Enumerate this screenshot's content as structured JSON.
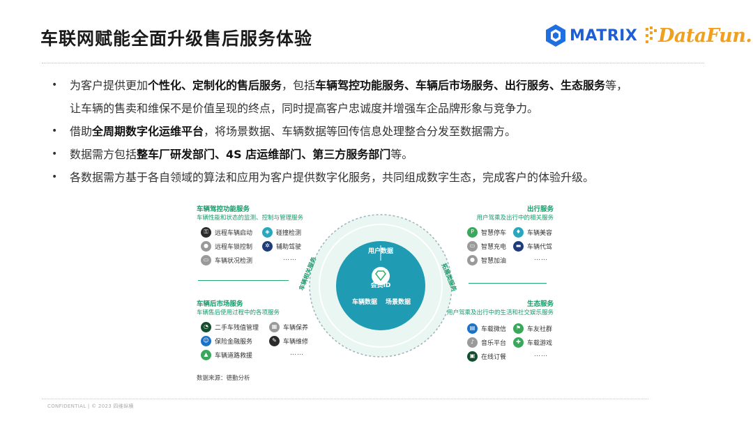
{
  "title": "车联网赋能全面升级售后服务体验",
  "logos": {
    "matrix": "MATRIX",
    "datafun": "DataFun."
  },
  "bullets": [
    {
      "line1": [
        {
          "t": "为客户提供更加",
          "b": false
        },
        {
          "t": "个性化、定制化的售后服务",
          "b": true
        },
        {
          "t": "，包括",
          "b": false
        },
        {
          "t": "车辆驾控功能服务、车辆后市场服务、出行服务、生态服务",
          "b": true
        },
        {
          "t": "等，",
          "b": false
        }
      ],
      "line2": "让车辆的售卖和维保不是价值呈现的终点，同时提高客户忠诚度并增强车企品牌形象与竞争力。"
    },
    {
      "line1": [
        {
          "t": "借助",
          "b": false
        },
        {
          "t": "全周期数字化运维平台",
          "b": true
        },
        {
          "t": "，将场景数据、车辆数据等回传信息处理整合分发至数据需方。",
          "b": false
        }
      ]
    },
    {
      "line1": [
        {
          "t": "数据需方包括",
          "b": false
        },
        {
          "t": "整车厂研发部门、4S 店运维部门、第三方服务部门",
          "b": true
        },
        {
          "t": "等。",
          "b": false
        }
      ]
    },
    {
      "line1": [
        {
          "t": "各数据需方基于各自领域的算法和应用为客户提供数字化服务，共同组成数字生态，完成客户的体验升级。",
          "b": false
        }
      ]
    }
  ],
  "diagram": {
    "driving": {
      "title": "车辆驾控功能服务",
      "subtitle": "车辆性能和状态的监测、控制与管理服务",
      "items": [
        "远程车辆启动",
        "碰撞检测",
        "远程车锁控制",
        "辅助驾驶",
        "车辆状况检测"
      ],
      "more": "……"
    },
    "aftermarket": {
      "title": "车辆后市场服务",
      "subtitle": "车辆售后使用过程中的各项服务",
      "items": [
        "二手车残值管理",
        "车辆保养",
        "保险金融服务",
        "车辆维修",
        "车辆道路救援"
      ],
      "more": "……"
    },
    "mobility": {
      "title": "出行服务",
      "subtitle": "用户驾乘及出行中的相关服务",
      "items": [
        "智慧停车",
        "车辆美容",
        "智慧充电",
        "车辆代驾",
        "智慧加油"
      ],
      "more": "……"
    },
    "ecosystem": {
      "title": "生态服务",
      "subtitle": "用户驾乘及出行中的生活和社交娱乐服务",
      "items": [
        "车载微信",
        "车友社群",
        "音乐平台",
        "车载游戏",
        "在线订餐"
      ],
      "more": "……"
    },
    "center": {
      "top": "用户数据",
      "id": "会员ID",
      "bottom_left": "车辆数据",
      "bottom_right": "场景数据"
    },
    "ring": {
      "left": "车辆相关服务",
      "right": "拓展类服务"
    },
    "source": "数据来源：德勤分析",
    "colors": {
      "accent": "#1a9a6a",
      "ring": "#2aa7bd",
      "core": "#1f9bb3"
    }
  },
  "footer": "CONFIDENTIAL | © 2023 四维纵横"
}
